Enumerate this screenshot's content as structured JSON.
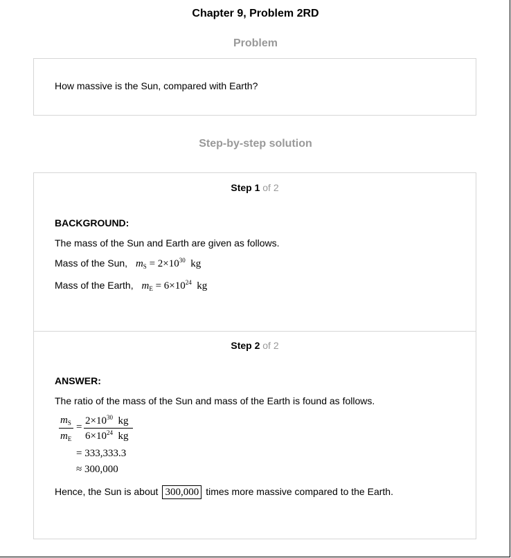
{
  "header": {
    "title": "Chapter 9, Problem 2RD"
  },
  "problem": {
    "heading": "Problem",
    "text": "How massive is the Sun, compared with Earth?"
  },
  "solution": {
    "heading": "Step-by-step solution",
    "steps": [
      {
        "label": "Step 1",
        "of": "of 2",
        "heading": "BACKGROUND:",
        "intro": "The mass of the Sun and Earth are given as follows.",
        "lines": [
          {
            "label": "Mass of the Sun,",
            "symbol": "m",
            "subscript": "S",
            "eq": "= 2×10",
            "exp": "30",
            "unit": "kg"
          },
          {
            "label": "Mass of the Earth,",
            "symbol": "m",
            "subscript": "E",
            "eq": "= 6×10",
            "exp": "24",
            "unit": "kg"
          }
        ]
      },
      {
        "label": "Step 2",
        "of": "of 2",
        "heading": "ANSWER:",
        "intro": "The ratio of the mass of the Sun and mass of the Earth is found as follows.",
        "ratio": {
          "lhs_num_symbol": "m",
          "lhs_num_sub": "S",
          "lhs_den_symbol": "m",
          "lhs_den_sub": "E",
          "eq": "=",
          "rhs_num_base": "2×10",
          "rhs_num_exp": "30",
          "rhs_num_unit": "kg",
          "rhs_den_base": "6×10",
          "rhs_den_exp": "24",
          "rhs_den_unit": "kg",
          "line2": "= 333,333.3",
          "line3": "≈ 300,000"
        },
        "conclusion_pre": "Hence, the Sun is about",
        "answer": "300,000",
        "conclusion_post": "times more massive compared to the Earth."
      }
    ]
  }
}
